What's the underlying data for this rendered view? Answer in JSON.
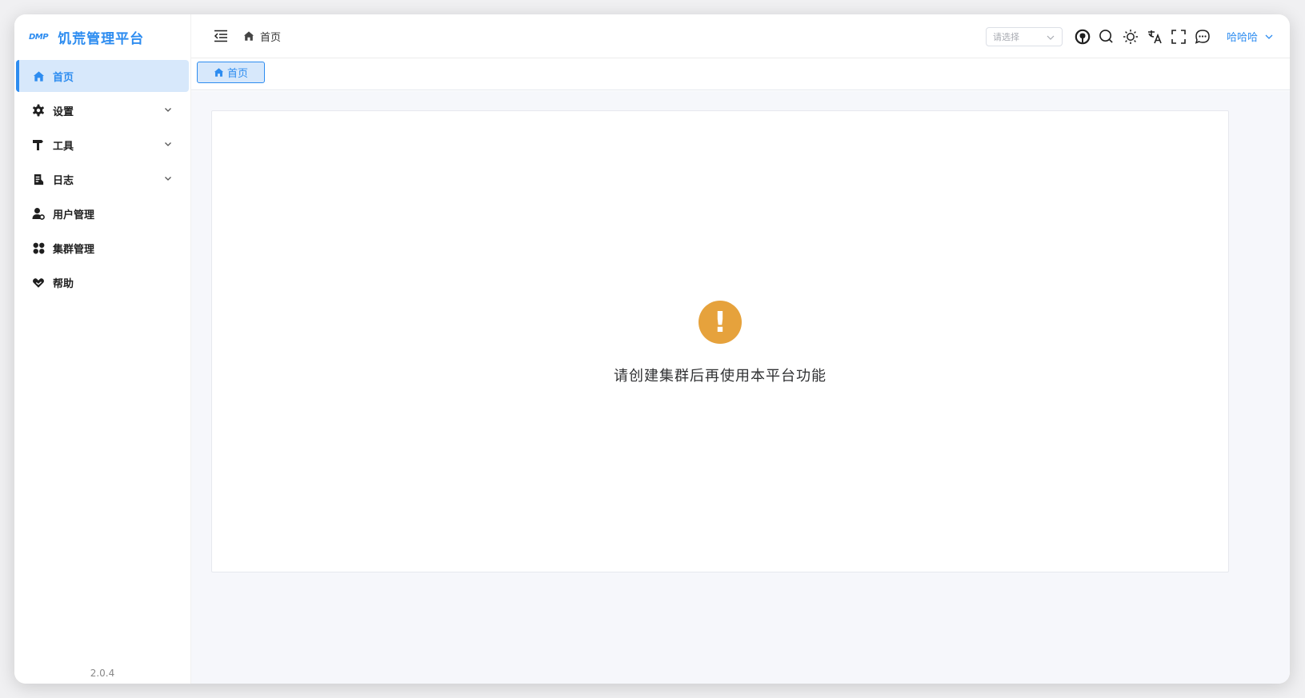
{
  "brand": {
    "logo": "DMP",
    "title": "饥荒管理平台"
  },
  "sidebar": {
    "items": [
      {
        "label": "首页",
        "icon": "home-icon",
        "active": true
      },
      {
        "label": "设置",
        "icon": "gear-icon",
        "expandable": true
      },
      {
        "label": "工具",
        "icon": "hammer-icon",
        "expandable": true
      },
      {
        "label": "日志",
        "icon": "document-icon",
        "expandable": true
      },
      {
        "label": "用户管理",
        "icon": "user-gear-icon"
      },
      {
        "label": "集群管理",
        "icon": "cluster-icon"
      },
      {
        "label": "帮助",
        "icon": "heart-hand-icon"
      }
    ],
    "version": "2.0.4"
  },
  "header": {
    "breadcrumb": "首页",
    "select_placeholder": "请选择",
    "icons": [
      "github-icon",
      "search-icon",
      "sun-icon",
      "translate-icon",
      "fullscreen-icon",
      "chat-icon"
    ],
    "username": "哈哈哈"
  },
  "tabs": [
    {
      "label": "首页",
      "icon": "home-icon"
    }
  ],
  "main": {
    "warning_icon": "exclamation-icon",
    "warning_glyph": "!",
    "message": "请创建集群后再使用本平台功能"
  },
  "colors": {
    "accent": "#2d8cf0",
    "active_bg": "#d7e8fb",
    "warning": "#e6a23c"
  }
}
